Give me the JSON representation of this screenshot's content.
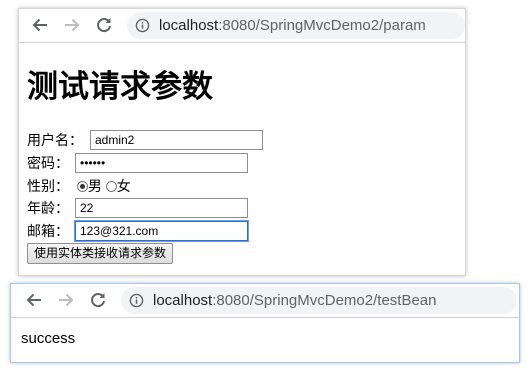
{
  "window1": {
    "address": {
      "host": "localhost",
      "rest": ":8080/SpringMvcDemo2/param"
    },
    "page_title": "测试请求参数",
    "form": {
      "username": {
        "label": "用户名：",
        "value": "admin2"
      },
      "password": {
        "label": "密码：",
        "value": "••••••"
      },
      "gender": {
        "label": "性别：",
        "options": [
          "男",
          "女"
        ],
        "selected": "男"
      },
      "age": {
        "label": "年龄：",
        "value": "22"
      },
      "email": {
        "label": "邮箱：",
        "value": "123@321.com"
      },
      "submit_label": "使用实体类接收请求参数"
    }
  },
  "window2": {
    "address": {
      "host": "localhost",
      "rest": ":8080/SpringMvcDemo2/testBean"
    },
    "body_text": "success"
  },
  "icons": {
    "back": "back-arrow-icon",
    "forward": "forward-arrow-icon",
    "reload": "reload-icon",
    "info": "info-icon"
  },
  "colors": {
    "focus_border": "#2f6fd0",
    "omnibox_bg": "#f1f3f4",
    "toolbar_icon": "#5f6368"
  }
}
